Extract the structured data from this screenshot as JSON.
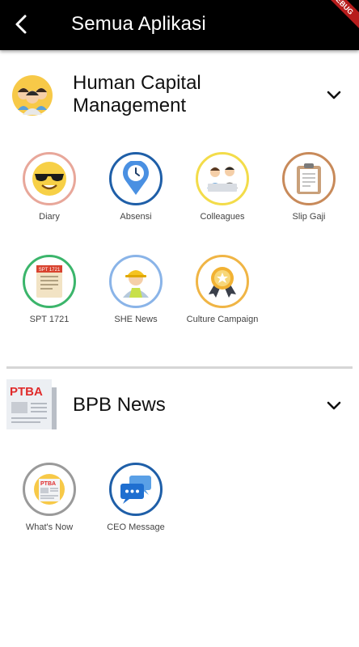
{
  "appbar": {
    "title": "Semua Aplikasi",
    "back_icon": "arrow-back-icon",
    "banner": "DEBUG",
    "banner_color": "#b71c1c"
  },
  "sections": [
    {
      "title_line1": "Human Capital",
      "title_line2": "Management",
      "icon": "people-group-icon",
      "apps": [
        {
          "label": "Diary",
          "icon": "sunglasses-emoji-icon",
          "ring": "#e8a79a"
        },
        {
          "label": "Absensi",
          "icon": "location-clock-icon",
          "ring": "#1f5fa8"
        },
        {
          "label": "Colleagues",
          "icon": "colleagues-icon",
          "ring": "#f3dc4a"
        },
        {
          "label": "Slip Gaji",
          "icon": "clipboard-icon",
          "ring": "#c88a5a"
        },
        {
          "label": "SPT 1721",
          "icon": "tax-document-icon",
          "ring": "#3bb56b",
          "badge": "SPT 1721"
        },
        {
          "label": "SHE News",
          "icon": "worker-helmet-icon",
          "ring": "#8ab4e8"
        },
        {
          "label": "Culture Campaign",
          "icon": "award-badge-icon",
          "ring": "#f0b545"
        }
      ]
    },
    {
      "title": "BPB News",
      "icon": "newspaper-icon",
      "logo_text": "PTBA",
      "apps": [
        {
          "label": "What's Now",
          "icon": "newspaper-icon",
          "ring": "#9a9a9a",
          "logo_text": "PTBA"
        },
        {
          "label": "CEO Message",
          "icon": "chat-bubbles-icon",
          "ring": "#1f5fa8"
        }
      ]
    }
  ]
}
